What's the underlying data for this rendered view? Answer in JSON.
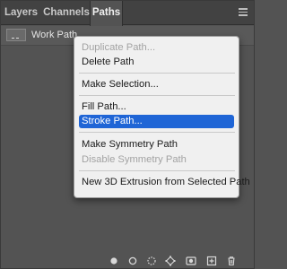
{
  "tabs": [
    {
      "label": "Layers"
    },
    {
      "label": "Channels"
    },
    {
      "label": "Paths",
      "active": true
    }
  ],
  "paths": [
    {
      "name": "Work Path"
    }
  ],
  "context_menu": {
    "items": [
      {
        "label": "Duplicate Path...",
        "enabled": false
      },
      {
        "label": "Delete Path",
        "enabled": true
      },
      {
        "label": "Make Selection...",
        "enabled": true
      },
      {
        "label": "Fill Path...",
        "enabled": true
      },
      {
        "label": "Stroke Path...",
        "enabled": true,
        "highlighted": true
      },
      {
        "label": "Make Symmetry Path",
        "enabled": true
      },
      {
        "label": "Disable Symmetry Path",
        "enabled": false
      },
      {
        "label": "New 3D Extrusion from Selected Path",
        "enabled": true
      }
    ]
  },
  "footer_icons": [
    "fill-path-icon",
    "stroke-path-icon",
    "load-as-selection-icon",
    "make-work-path-icon",
    "add-mask-icon",
    "new-path-icon",
    "delete-path-icon"
  ],
  "colors": {
    "panel_bg": "#535353",
    "tabbar_bg": "#424242",
    "menu_bg": "#f0f0f0",
    "highlight": "#1f65d6"
  }
}
